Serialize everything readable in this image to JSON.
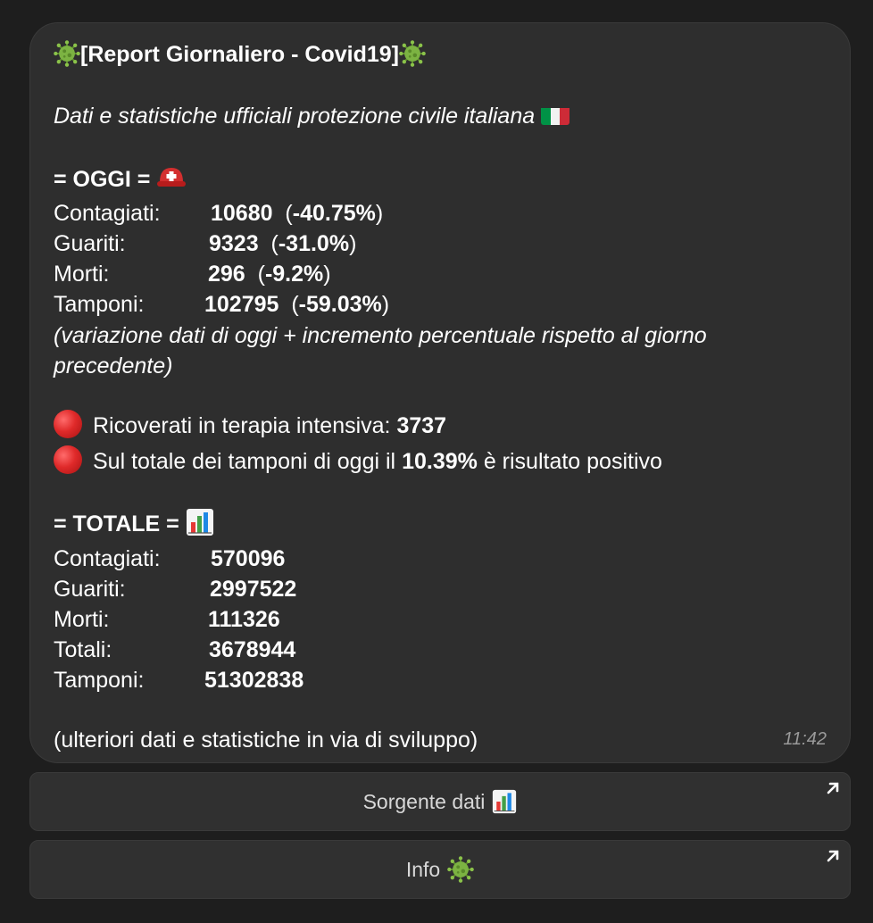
{
  "message": {
    "title": "[Report Giornaliero - Covid19]",
    "subtitle": "Dati e statistiche ufficiali protezione civile italiana",
    "today_header": "= OGGI =",
    "today": [
      {
        "label": "Contagiati:",
        "value": "10680",
        "pct": "(-40.75%)"
      },
      {
        "label": "Guariti:",
        "value": "9323",
        "pct": "(-31.0%)"
      },
      {
        "label": "Morti:",
        "value": "296",
        "pct": "(-9.2%)"
      },
      {
        "label": "Tamponi:",
        "value": "102795",
        "pct": "(-59.03%)"
      }
    ],
    "note_line1": "(variazione dati di oggi + incremento percentuale rispetto al giorno",
    "note_line2": "precedente)",
    "icu_label": "Ricoverati in terapia intensiva:",
    "icu_value": "3737",
    "positive_prefix": "Sul totale dei tamponi di oggi il",
    "positive_value": "10.39%",
    "positive_suffix": "è risultato positivo",
    "total_header": "= TOTALE =",
    "totals": [
      {
        "label": "Contagiati:",
        "value": "570096"
      },
      {
        "label": "Guariti:",
        "value": "2997522"
      },
      {
        "label": "Morti:",
        "value": "111326"
      },
      {
        "label": "Totali:",
        "value": "3678944"
      },
      {
        "label": "Tamponi:",
        "value": "51302838"
      }
    ],
    "footer": "(ulteriori dati e statistiche in via di sviluppo)",
    "time": "11:42"
  },
  "buttons": {
    "source": "Sorgente dati",
    "info": "Info"
  },
  "icons": {
    "virus": "virus-icon",
    "helmet": "rescue-helmet-icon",
    "flag": "italy-flag-icon",
    "chart": "bar-chart-icon",
    "dot": "red-circle-icon",
    "arrow": "external-arrow-icon"
  },
  "colors": {
    "background": "#1e1e1e",
    "bubble": "#2e2e2e",
    "virus": "#7cb342",
    "red": "#e02a2a",
    "time": "#9a9a9a"
  }
}
